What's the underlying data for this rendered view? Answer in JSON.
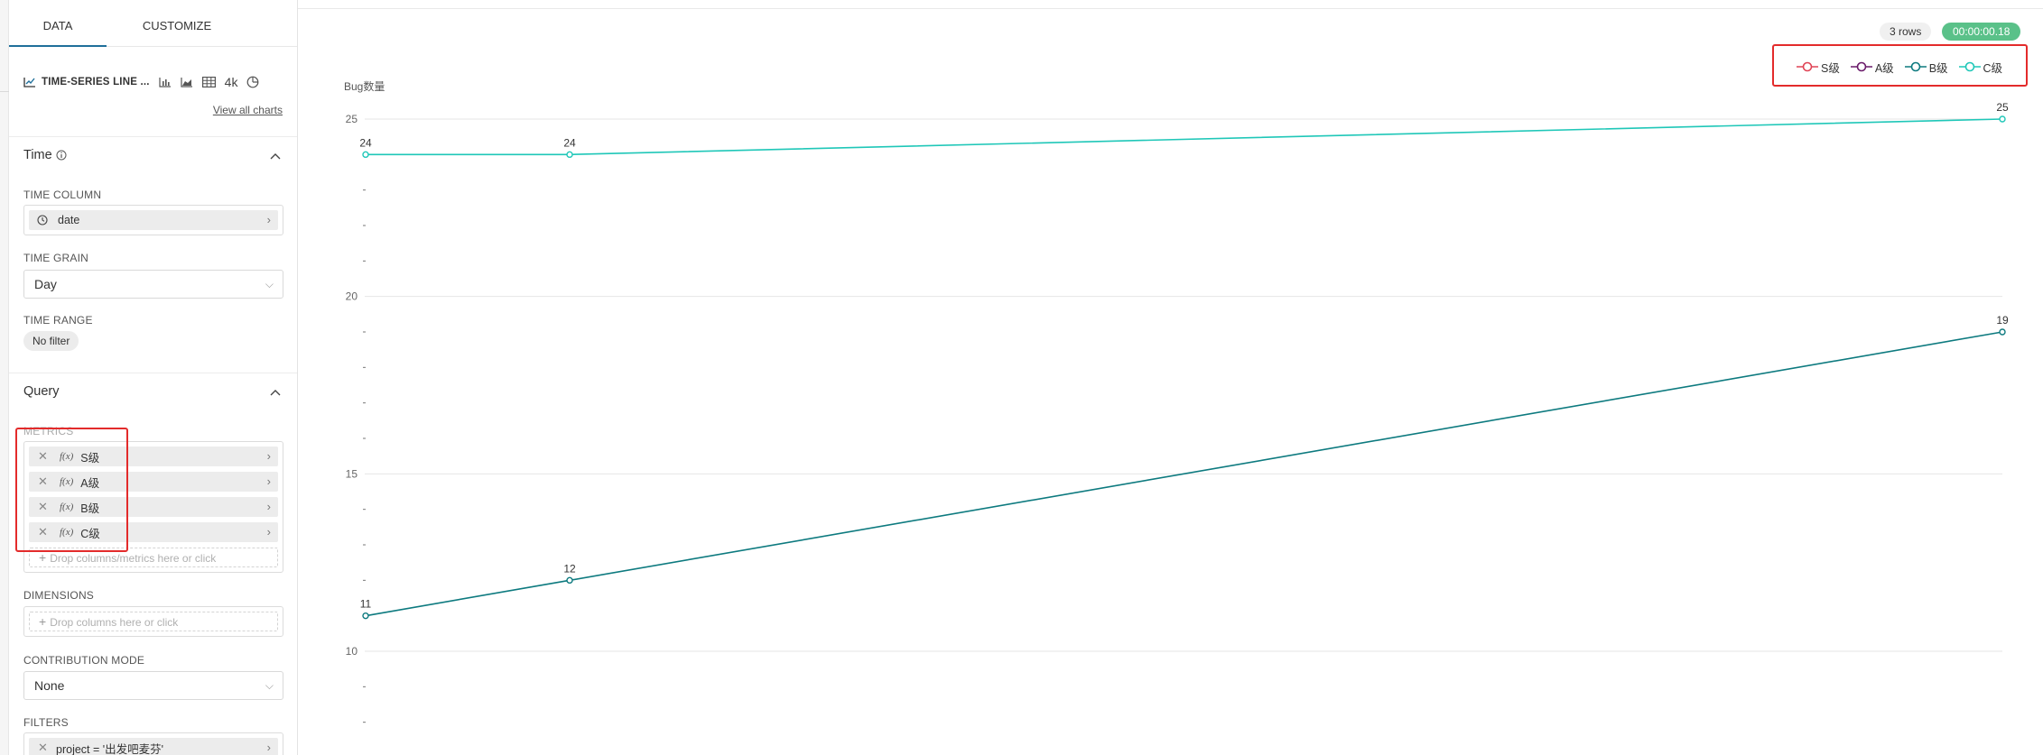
{
  "tabs": {
    "data": "DATA",
    "customize": "CUSTOMIZE"
  },
  "viz": {
    "type_label": "TIME-SERIES LINE ...",
    "icons": [
      "bar-chart-icon",
      "area-chart-icon",
      "table-icon",
      "big-number-icon",
      "pie-chart-icon"
    ],
    "big_number_label": "4k",
    "view_all": "View all charts"
  },
  "time": {
    "title": "Time",
    "time_column_label": "TIME COLUMN",
    "time_column_value": "date",
    "time_grain_label": "TIME GRAIN",
    "time_grain_value": "Day",
    "time_range_label": "TIME RANGE",
    "time_range_value": "No filter"
  },
  "query": {
    "title": "Query",
    "metrics_label": "METRICS",
    "metrics": [
      {
        "fx": "f(x)",
        "name": "S级"
      },
      {
        "fx": "f(x)",
        "name": "A级"
      },
      {
        "fx": "f(x)",
        "name": "B级"
      },
      {
        "fx": "f(x)",
        "name": "C级"
      }
    ],
    "metrics_drop": "Drop columns/metrics here or click",
    "dimensions_label": "DIMENSIONS",
    "dimensions_drop": "Drop columns here or click",
    "contribution_label": "CONTRIBUTION MODE",
    "contribution_value": "None",
    "filters_label": "FILTERS",
    "filter_value": "project = '出发吧麦芬'"
  },
  "status": {
    "rows": "3 rows",
    "time": "00:00:00.18"
  },
  "colors": {
    "S级": "#e04355",
    "A级": "#6a1a6a",
    "B级": "#0d7a7f",
    "C级": "#1fc7b8",
    "accent": "#1f6f9a",
    "success": "#5ac189"
  },
  "chart_data": {
    "type": "line",
    "ylabel": "Bug数量",
    "ylim": [
      7,
      25
    ],
    "y_ticks": [
      10,
      15,
      20,
      25
    ],
    "x": [
      1,
      2,
      3
    ],
    "series": [
      {
        "name": "S级",
        "values": []
      },
      {
        "name": "A级",
        "values": []
      },
      {
        "name": "B级",
        "values": [
          11,
          12,
          19
        ]
      },
      {
        "name": "C级",
        "values": [
          24,
          24,
          25
        ]
      }
    ],
    "data_labels": true,
    "legend": "top-right",
    "grid": true
  }
}
